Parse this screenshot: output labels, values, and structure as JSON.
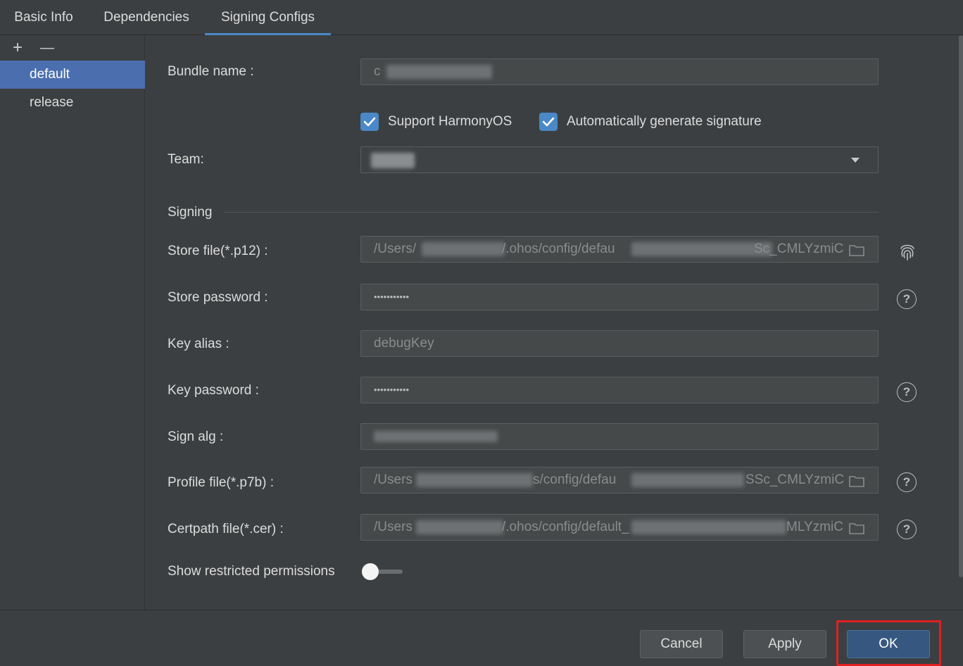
{
  "tabs": [
    {
      "label": "Basic Info",
      "active": false
    },
    {
      "label": "Dependencies",
      "active": false
    },
    {
      "label": "Signing Configs",
      "active": true
    }
  ],
  "left_panel": {
    "add_label": "+",
    "remove_label": "—",
    "items": [
      {
        "label": "default",
        "selected": true
      },
      {
        "label": "release",
        "selected": false
      }
    ]
  },
  "form": {
    "bundle_name_label": "Bundle name :",
    "bundle_name_value": "c",
    "support_harmonyos_label": "Support HarmonyOS",
    "support_harmonyos_checked": true,
    "auto_signature_label": "Automatically generate signature",
    "auto_signature_checked": true,
    "team_label": "Team:",
    "signing_section": "Signing",
    "store_file_label": "Store file(*.p12) :",
    "store_file_value_a": "/Users/",
    "store_file_value_b": "/.ohos/config/defau",
    "store_file_value_c": "Sc_CMLYzmiC",
    "store_password_label": "Store password :",
    "store_password_value": "•••••••••••",
    "key_alias_label": "Key alias :",
    "key_alias_value": "debugKey",
    "key_password_label": "Key password :",
    "key_password_value": "•••••••••••",
    "sign_alg_label": "Sign alg :",
    "profile_file_label": "Profile file(*.p7b) :",
    "profile_file_value_a": "/Users",
    "profile_file_value_b": "s/config/defau",
    "profile_file_value_c": "SSc_CMLYzmiC",
    "certpath_file_label": "Certpath file(*.cer) :",
    "certpath_file_value_a": "/Users",
    "certpath_file_value_b": "/.ohos/config/default_",
    "certpath_file_value_c": "MLYzmiC",
    "show_restricted_label": "Show restricted permissions",
    "show_restricted_on": false,
    "help_glyph": "?"
  },
  "icons": {
    "folder": "folder-icon",
    "fingerprint": "fingerprint-icon",
    "help": "help-icon",
    "dropdown": "chevron-down-icon",
    "check": "check-icon"
  },
  "buttons": {
    "cancel": "Cancel",
    "apply": "Apply",
    "ok": "OK"
  },
  "colors": {
    "accent": "#4a88c7",
    "selection": "#4b6eaf",
    "highlight": "#e02020"
  }
}
